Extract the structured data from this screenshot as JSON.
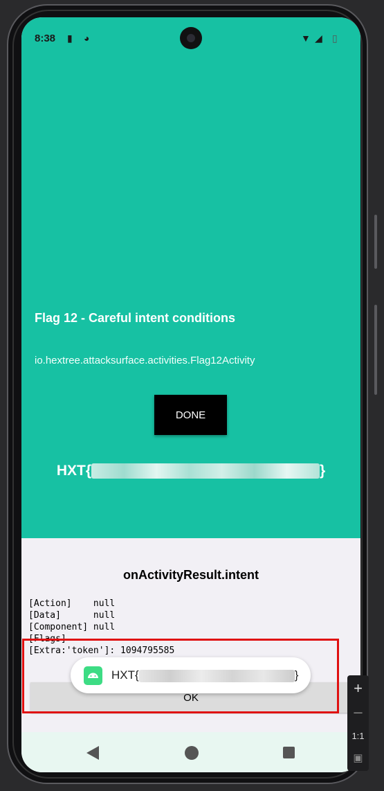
{
  "status_bar": {
    "time": "8:38"
  },
  "app": {
    "title": "Flag 12 - Careful intent conditions",
    "activity_class": "io.hextree.attacksurface.activities.Flag12Activity",
    "done_label": "DONE",
    "flag_prefix": "HXT{",
    "flag_suffix": "}"
  },
  "result_panel": {
    "title": "onActivityResult.intent",
    "lines": [
      "[Action]    null",
      "[Data]      null",
      "[Component] null",
      "[Flags]",
      "[Extra:'token']: 1094795585"
    ],
    "ok_label": "OK"
  },
  "toast": {
    "prefix": "HXT{",
    "suffix": "}"
  },
  "emulator_toolbar": {
    "zoom_label": "1:1"
  },
  "colors": {
    "app_background": "#17c1a3",
    "highlight_border": "#e01010"
  }
}
